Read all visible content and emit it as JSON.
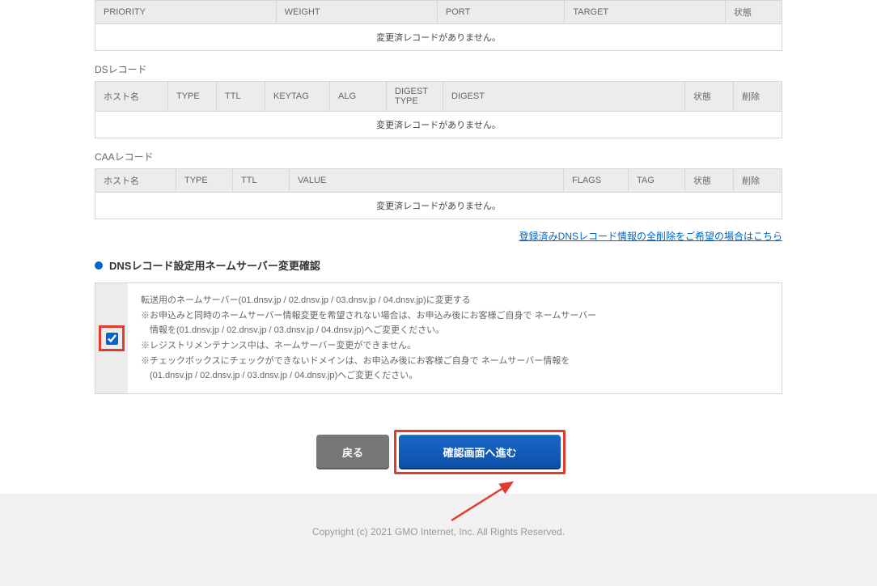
{
  "srv_table": {
    "headers": [
      "PRIORITY",
      "WEIGHT",
      "PORT",
      "TARGET",
      "状態"
    ],
    "empty_message": "変更済レコードがありません。"
  },
  "ds_section": {
    "label": "DSレコード",
    "headers": [
      "ホスト名",
      "TYPE",
      "TTL",
      "KEYTAG",
      "ALG",
      "DIGEST TYPE",
      "DIGEST",
      "状態",
      "削除"
    ],
    "empty_message": "変更済レコードがありません。"
  },
  "caa_section": {
    "label": "CAAレコード",
    "headers": [
      "ホスト名",
      "TYPE",
      "TTL",
      "VALUE",
      "FLAGS",
      "TAG",
      "状態",
      "削除"
    ],
    "empty_message": "変更済レコードがありません。"
  },
  "delete_all_link": "登録済みDNSレコード情報の全削除をご希望の場合はこちら",
  "nameserver_heading": "DNSレコード設定用ネームサーバー変更確認",
  "confirm_text": {
    "line1": "転送用のネームサーバー(01.dnsv.jp / 02.dnsv.jp / 03.dnsv.jp / 04.dnsv.jp)に変更する",
    "line2": "※お申込みと同時のネームサーバー情報変更を希望されない場合は、お申込み後にお客様ご自身で ネームサーバー",
    "line3": "　情報を(01.dnsv.jp / 02.dnsv.jp / 03.dnsv.jp / 04.dnsv.jp)へご変更ください。",
    "line4": "※レジストリメンテナンス中は、ネームサーバー変更ができません。",
    "line5": "※チェックボックスにチェックができないドメインは、お申込み後にお客様ご自身で ネームサーバー情報を",
    "line6": "　(01.dnsv.jp / 02.dnsv.jp / 03.dnsv.jp / 04.dnsv.jp)へご変更ください。"
  },
  "buttons": {
    "back": "戻る",
    "proceed": "確認画面へ進む"
  },
  "copyright": "Copyright (c) 2021 GMO Internet, Inc. All Rights Reserved."
}
